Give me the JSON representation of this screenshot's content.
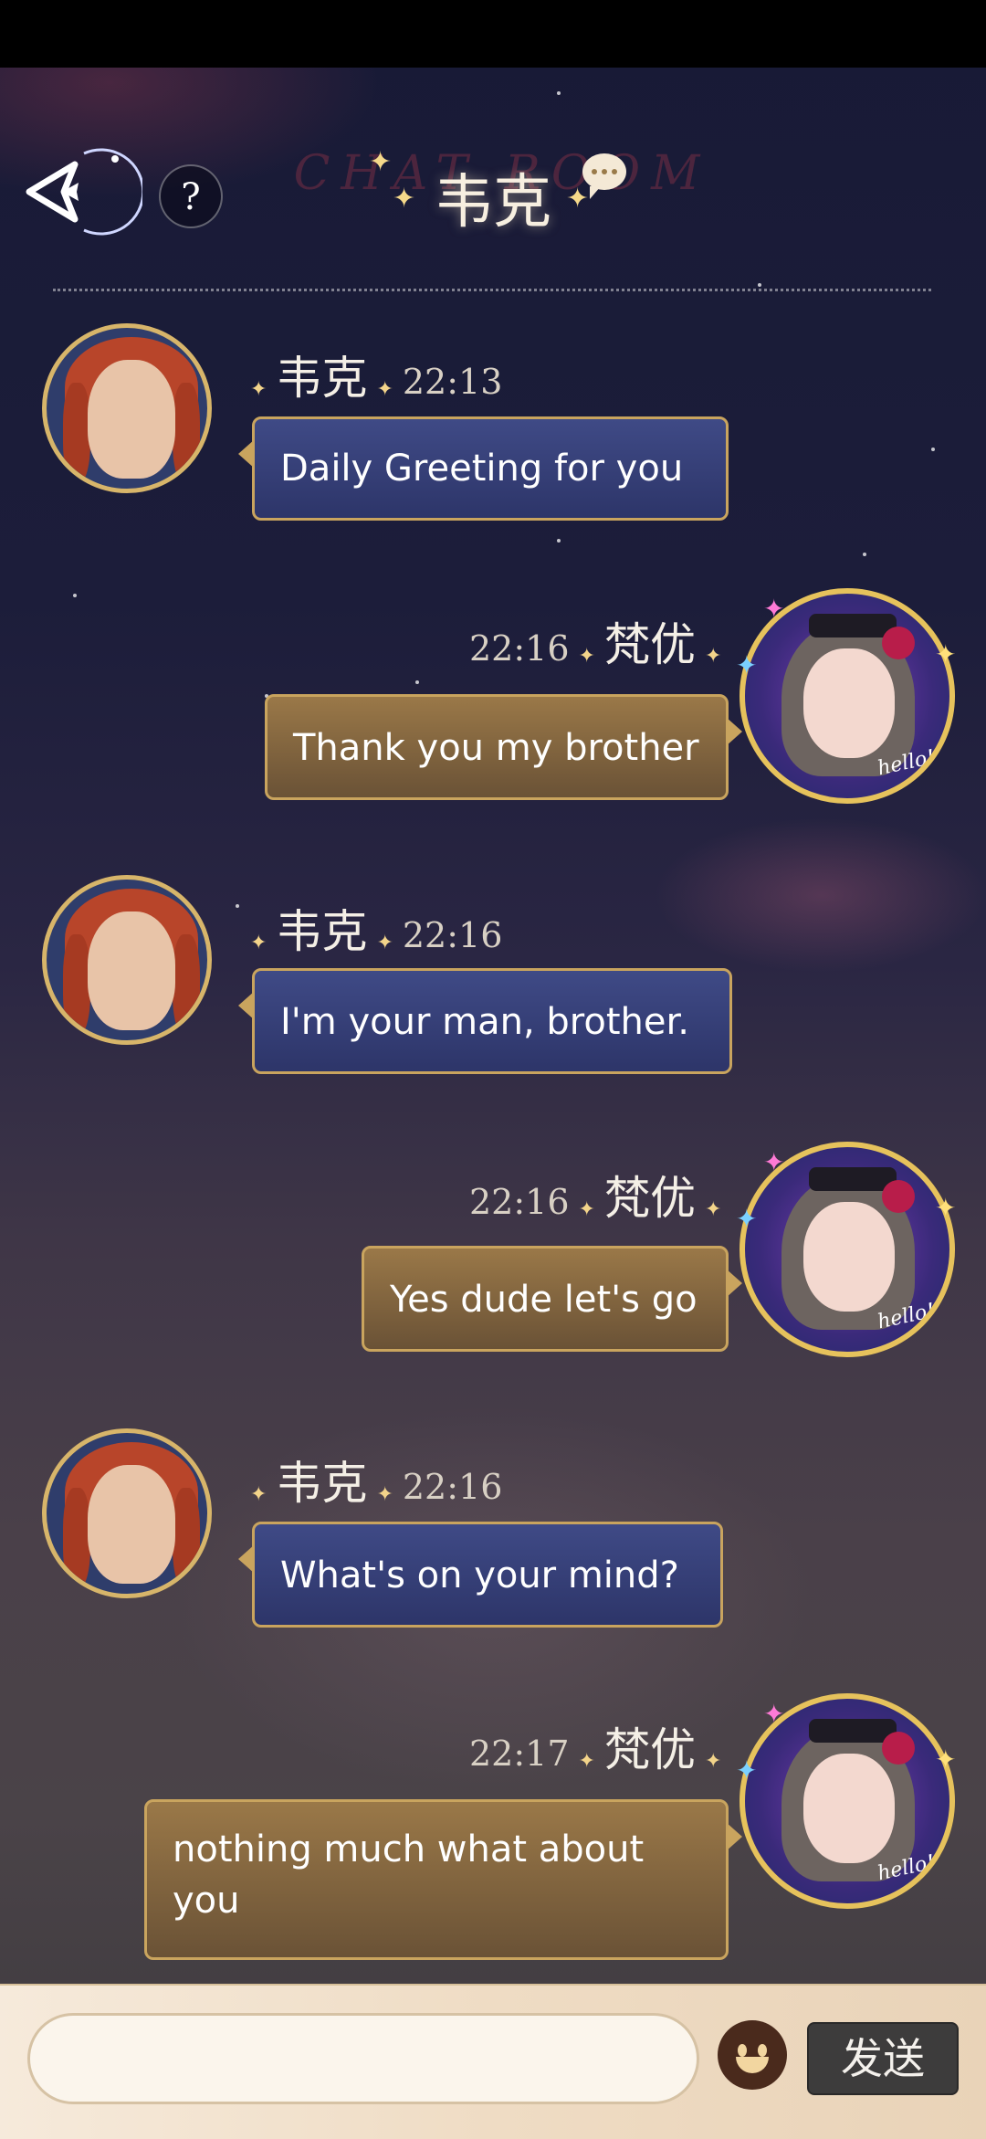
{
  "header": {
    "title": "韦克",
    "background_title": "CHAT ROOM",
    "back_icon": "back-arrow-icon",
    "help_label": "?",
    "chat_icon": "chat-bubble-icon"
  },
  "contacts": {
    "other_name": "韦克",
    "self_name": "梵优",
    "self_avatar_badge": "hello!"
  },
  "messages": [
    {
      "sender": "韦克",
      "side": "left",
      "time": "22:13",
      "text": "Daily Greeting for you"
    },
    {
      "sender": "梵优",
      "side": "right",
      "time": "22:16",
      "text": "Thank you my brother"
    },
    {
      "sender": "韦克",
      "side": "left",
      "time": "22:16",
      "text": "I'm your man, brother."
    },
    {
      "sender": "梵优",
      "side": "right",
      "time": "22:16",
      "text": "Yes dude let's go"
    },
    {
      "sender": "韦克",
      "side": "left",
      "time": "22:16",
      "text": "What's on your mind?"
    },
    {
      "sender": "梵优",
      "side": "right",
      "time": "22:17",
      "text": "nothing much what about you"
    }
  ],
  "input": {
    "value": "",
    "placeholder": "",
    "emoji_icon": "emoji-face-icon",
    "send_label": "发送"
  },
  "colors": {
    "left_bubble": "#3a4480",
    "right_bubble": "#8a6a40",
    "bubble_border": "#c9a45e",
    "send_button": "#3d3c3c"
  }
}
